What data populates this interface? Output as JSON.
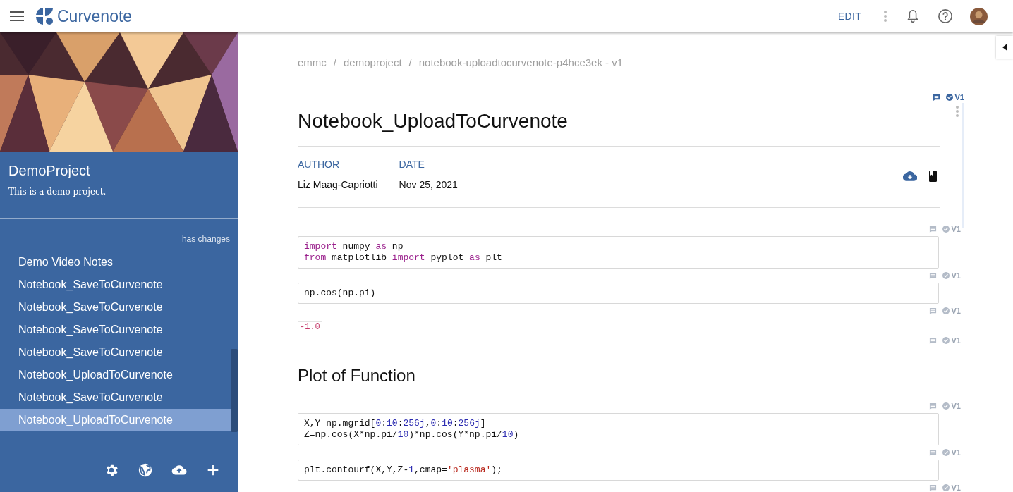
{
  "topbar": {
    "brand": "Curvenote",
    "edit": "EDIT"
  },
  "sidebar": {
    "title": "DemoProject",
    "description": "This is a demo project.",
    "status": "has changes",
    "items": [
      {
        "label": "Demo Video Notes",
        "selected": false
      },
      {
        "label": "Notebook_SaveToCurvenote",
        "selected": false
      },
      {
        "label": "Notebook_SaveToCurvenote",
        "selected": false
      },
      {
        "label": "Notebook_SaveToCurvenote",
        "selected": false
      },
      {
        "label": "Notebook_SaveToCurvenote",
        "selected": false
      },
      {
        "label": "Notebook_UploadToCurvenote",
        "selected": false
      },
      {
        "label": "Notebook_SaveToCurvenote",
        "selected": false
      },
      {
        "label": "Notebook_UploadToCurvenote",
        "selected": true
      }
    ]
  },
  "breadcrumbs": {
    "separator": "/",
    "items": [
      "emmc",
      "demoproject",
      "notebook-uploadtocurvenote-p4hce3ek - v1"
    ]
  },
  "article": {
    "title": "Notebook_UploadToCurvenote",
    "selected": true,
    "marker": {
      "label": "V1",
      "active": true
    },
    "meta": [
      {
        "heading": "AUTHOR",
        "value": "Liz Maag-Capriotti"
      },
      {
        "heading": "DATE",
        "value": "Nov 25, 2021"
      }
    ]
  },
  "blocks": [
    {
      "kind": "code",
      "marker": {
        "label": "V1",
        "active": false
      },
      "lines": [
        [
          {
            "kind": "kw",
            "text": "import"
          },
          {
            "kind": "plain",
            "text": " numpy "
          },
          {
            "kind": "kw",
            "text": "as"
          },
          {
            "kind": "plain",
            "text": " np"
          }
        ],
        [
          {
            "kind": "kw",
            "text": "from"
          },
          {
            "kind": "plain",
            "text": " matplotlib "
          },
          {
            "kind": "kw",
            "text": "import"
          },
          {
            "kind": "plain",
            "text": " pyplot "
          },
          {
            "kind": "kw",
            "text": "as"
          },
          {
            "kind": "plain",
            "text": " plt"
          }
        ]
      ]
    },
    {
      "kind": "code",
      "marker": {
        "label": "V1",
        "active": false
      },
      "lines": [
        [
          {
            "kind": "plain",
            "text": "np.cos(np.pi)"
          }
        ]
      ]
    },
    {
      "kind": "output",
      "marker": {
        "label": "V1",
        "active": false
      },
      "text": "-1.0"
    },
    {
      "kind": "heading",
      "marker": {
        "label": "V1",
        "active": false
      },
      "text": "Plot of Function"
    },
    {
      "kind": "code",
      "marker": {
        "label": "V1",
        "active": false
      },
      "lines": [
        [
          {
            "kind": "plain",
            "text": "X,Y=np.mgrid["
          },
          {
            "kind": "num",
            "text": "0"
          },
          {
            "kind": "plain",
            "text": ":"
          },
          {
            "kind": "num",
            "text": "10"
          },
          {
            "kind": "plain",
            "text": ":"
          },
          {
            "kind": "num",
            "text": "256j"
          },
          {
            "kind": "plain",
            "text": ","
          },
          {
            "kind": "num",
            "text": "0"
          },
          {
            "kind": "plain",
            "text": ":"
          },
          {
            "kind": "num",
            "text": "10"
          },
          {
            "kind": "plain",
            "text": ":"
          },
          {
            "kind": "num",
            "text": "256j"
          },
          {
            "kind": "plain",
            "text": "]"
          }
        ],
        [
          {
            "kind": "plain",
            "text": "Z=np.cos(X*np.pi/"
          },
          {
            "kind": "num",
            "text": "10"
          },
          {
            "kind": "plain",
            "text": ")*np.cos(Y*np.pi/"
          },
          {
            "kind": "num",
            "text": "10"
          },
          {
            "kind": "plain",
            "text": ")"
          }
        ]
      ]
    },
    {
      "kind": "code",
      "marker": {
        "label": "V1",
        "active": false
      },
      "lines": [
        [
          {
            "kind": "plain",
            "text": "plt.contourf(X,Y,Z-"
          },
          {
            "kind": "num",
            "text": "1"
          },
          {
            "kind": "plain",
            "text": ",cmap="
          },
          {
            "kind": "str",
            "text": "'plasma'"
          },
          {
            "kind": "plain",
            "text": ");"
          }
        ]
      ]
    },
    {
      "kind": "offscreen",
      "marker": {
        "label": "V1",
        "active": false
      }
    }
  ]
}
